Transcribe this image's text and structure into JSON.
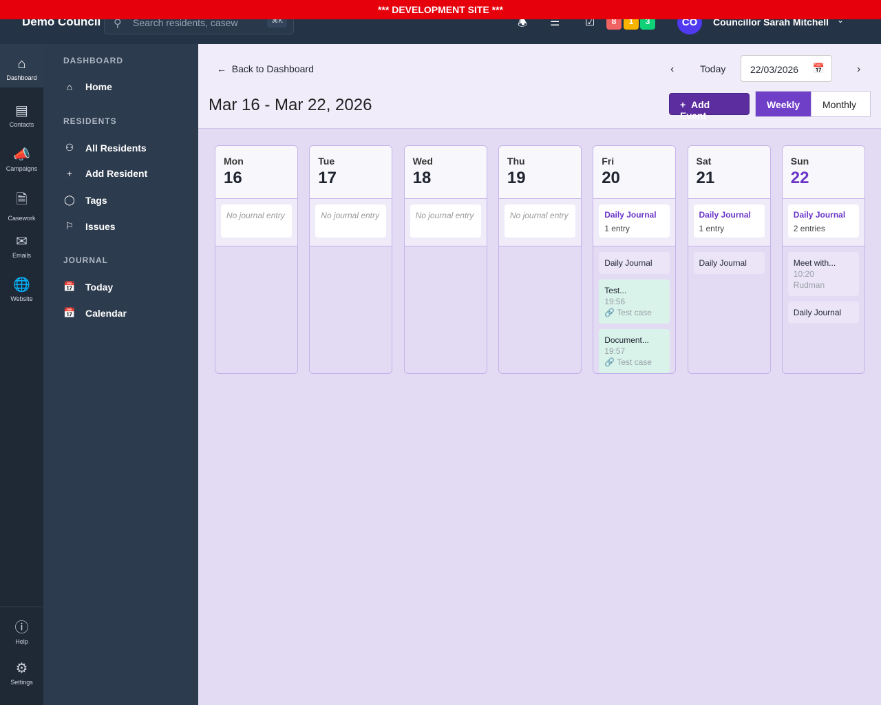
{
  "banner": "*** DEVELOPMENT SITE ***",
  "topbar": {
    "brand": "Demo Council",
    "search_placeholder": "Search residents, casew",
    "shortcut": "⌘K",
    "badges": [
      {
        "value": "8",
        "color": "#f16262"
      },
      {
        "value": "1",
        "color": "#f9b400"
      },
      {
        "value": "3",
        "color": "#0fd177"
      }
    ],
    "avatar": "CO",
    "user": "Councillor Sarah Mitchell"
  },
  "rail": [
    {
      "label": "Dashboard"
    },
    {
      "label": "Contacts"
    },
    {
      "label": "Campaigns"
    },
    {
      "label": "Casework"
    },
    {
      "label": "Emails"
    },
    {
      "label": "Website"
    },
    {
      "label": "Help"
    },
    {
      "label": "Settings"
    }
  ],
  "sidebar": {
    "sections": [
      {
        "title": "DASHBOARD",
        "items": [
          "Home"
        ]
      },
      {
        "title": "RESIDENTS",
        "items": [
          "All Residents",
          "Add Resident",
          "Tags",
          "Issues"
        ]
      },
      {
        "title": "JOURNAL",
        "items": [
          "Today",
          "Calendar"
        ]
      }
    ]
  },
  "header": {
    "back": "Back to Dashboard",
    "title": "Mar 16 - Mar 22, 2026",
    "today": "Today",
    "date": "22/03/2026",
    "add_event": "Add Event",
    "weekly": "Weekly",
    "monthly": "Monthly"
  },
  "days": [
    {
      "name": "Mon",
      "num": "16",
      "journal": null,
      "no_entry": "No journal entry",
      "events": []
    },
    {
      "name": "Tue",
      "num": "17",
      "journal": null,
      "no_entry": "No journal entry",
      "events": []
    },
    {
      "name": "Wed",
      "num": "18",
      "journal": null,
      "no_entry": "No journal entry",
      "events": []
    },
    {
      "name": "Thu",
      "num": "19",
      "journal": null,
      "no_entry": "No journal entry",
      "events": []
    },
    {
      "name": "Fri",
      "num": "20",
      "journal": {
        "title": "Daily Journal",
        "count": "1 entry"
      },
      "events": [
        {
          "title": "Daily Journal"
        },
        {
          "title": "Test...",
          "time": "19:56",
          "link": "Test case",
          "green": true
        },
        {
          "title": "Document...",
          "time": "19:57",
          "link": "Test case",
          "green": true
        }
      ]
    },
    {
      "name": "Sat",
      "num": "21",
      "journal": {
        "title": "Daily Journal",
        "count": "1 entry"
      },
      "events": [
        {
          "title": "Daily Journal"
        }
      ]
    },
    {
      "name": "Sun",
      "num": "22",
      "today": true,
      "journal": {
        "title": "Daily Journal",
        "count": "2 entries"
      },
      "events": [
        {
          "title": "Meet with...",
          "time": "10:20",
          "sub": "Rudman"
        },
        {
          "title": "Daily Journal"
        }
      ]
    }
  ]
}
